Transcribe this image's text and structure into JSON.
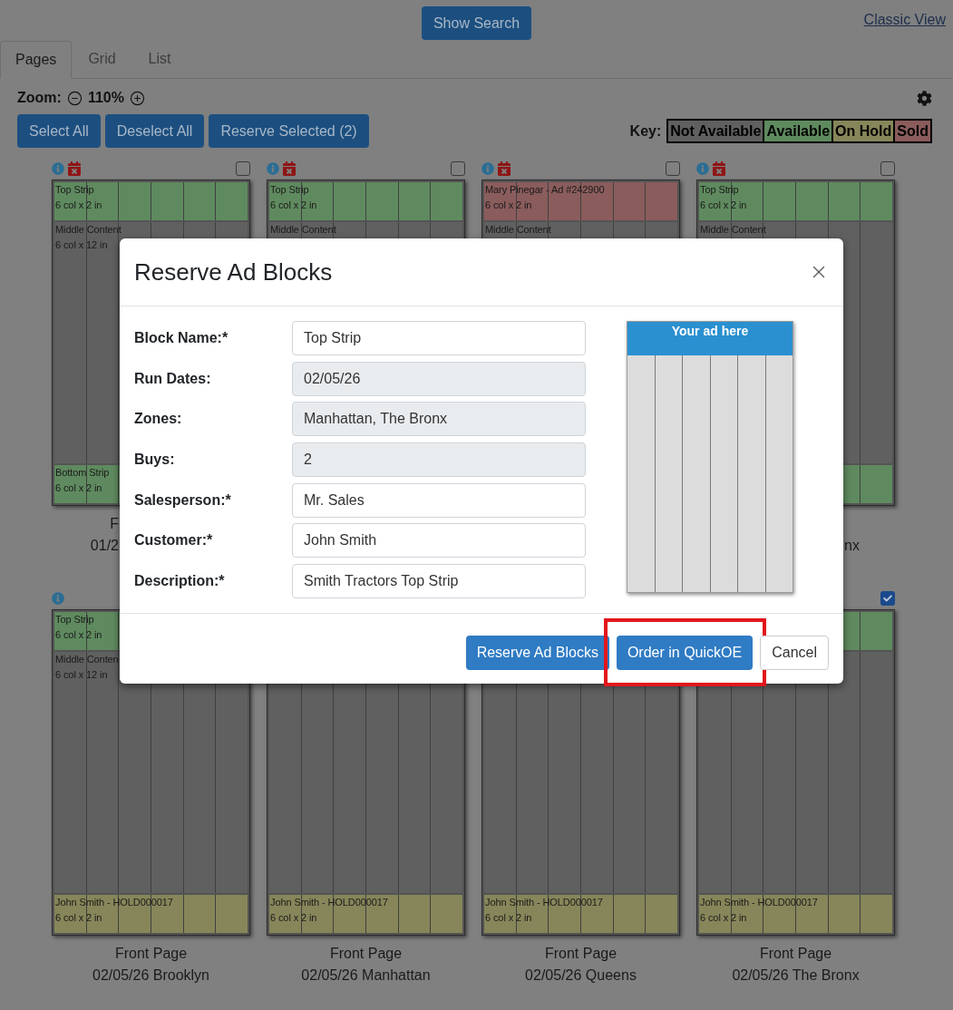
{
  "header": {
    "search_button": "Show Search",
    "classic_view_link": "Classic View"
  },
  "tabs": [
    {
      "label": "Pages",
      "selected": true
    },
    {
      "label": "Grid",
      "selected": false
    },
    {
      "label": "List",
      "selected": false
    }
  ],
  "toolbar": {
    "zoom_label": "Zoom:",
    "zoom_value": "110%",
    "buttons": [
      "Select All",
      "Deselect All",
      "Reserve Selected (2)"
    ]
  },
  "key": {
    "label": "Key:",
    "items": [
      {
        "label": "Not Available",
        "color": "#606060"
      },
      {
        "label": "Available",
        "color": "#5f8a5f"
      },
      {
        "label": "On Hold",
        "color": "#86865a"
      },
      {
        "label": "Sold",
        "color": "#8a5c5c"
      }
    ]
  },
  "page_rows": [
    {
      "cards": [
        {
          "info": true,
          "calendar_alert": true,
          "checkbox": {
            "checked": false
          },
          "strips": [
            {
              "kind": "strip",
              "color": "#5f8a5f",
              "lines": [
                "Top Strip",
                "6 col x 2 in"
              ]
            },
            {
              "kind": "content",
              "color": "#606060",
              "lines": [
                "Middle Content",
                "6 col x 12 in"
              ]
            },
            {
              "kind": "strip",
              "color": "#5f8a5f",
              "lines": [
                "Bottom Strip",
                "6 col x 2 in"
              ]
            }
          ],
          "caption": {
            "title": "F",
            "subtitle": "01/2"
          }
        },
        {
          "info": true,
          "calendar_alert": true,
          "checkbox": {
            "checked": false
          },
          "strips": [
            {
              "kind": "strip",
              "color": "#5f8a5f",
              "lines": [
                "Top Strip",
                "6 col x 2 in"
              ]
            },
            {
              "kind": "content",
              "color": "#606060",
              "lines": [
                "Middle Content"
              ]
            }
          ]
        },
        {
          "info": true,
          "calendar_alert": true,
          "checkbox": {
            "checked": false
          },
          "strips": [
            {
              "kind": "strip",
              "color": "#8a5c5c",
              "lines": [
                "Mary Pinegar - Ad #242900",
                "6 col x 2 in"
              ]
            },
            {
              "kind": "content",
              "color": "#606060",
              "lines": [
                "Middle Content"
              ]
            }
          ]
        },
        {
          "info": true,
          "calendar_alert": true,
          "checkbox": {
            "checked": false
          },
          "strips": [
            {
              "kind": "strip",
              "color": "#5f8a5f",
              "lines": [
                "Top Strip",
                "6 col x 2 in"
              ]
            },
            {
              "kind": "content",
              "color": "#606060",
              "lines": [
                "Middle Content"
              ]
            },
            {
              "kind": "strip",
              "color": "#5f8a5f"
            }
          ],
          "caption": {
            "subtitle": "nx"
          }
        }
      ]
    },
    {
      "cards": [
        {
          "info": true,
          "strips": [
            {
              "kind": "strip",
              "color": "#5f8a5f",
              "lines": [
                "Top Strip",
                "6 col x 2 in"
              ]
            },
            {
              "kind": "content",
              "color": "#606060",
              "lines": [
                "Middle Conten",
                "6 col x 12 in"
              ]
            },
            {
              "kind": "strip",
              "color": "#86865a",
              "lines": [
                "John Smith - HOLD000017",
                "6 col x 2 in"
              ]
            }
          ],
          "caption": {
            "title": "Front Page",
            "subtitle": "02/05/26 Brooklyn"
          }
        },
        {
          "strips": [
            {
              "kind": "content",
              "color": "#606060"
            },
            {
              "kind": "strip",
              "color": "#86865a",
              "lines": [
                "John Smith - HOLD000017",
                "6 col x 2 in"
              ]
            }
          ],
          "caption": {
            "title": "Front Page",
            "subtitle": "02/05/26 Manhattan"
          }
        },
        {
          "strips": [
            {
              "kind": "content",
              "color": "#606060"
            },
            {
              "kind": "strip",
              "color": "#86865a",
              "lines": [
                "John Smith - HOLD000017",
                "6 col x 2 in"
              ]
            }
          ],
          "caption": {
            "title": "Front Page",
            "subtitle": "02/05/26 Queens"
          }
        },
        {
          "checkbox": {
            "checked": true
          },
          "strips": [
            {
              "kind": "strip",
              "color": "#5f8a5f"
            },
            {
              "kind": "content",
              "color": "#606060"
            },
            {
              "kind": "strip",
              "color": "#86865a",
              "lines": [
                "John Smith - HOLD000017",
                "6 col x 2 in"
              ]
            }
          ],
          "caption": {
            "title": "Front Page",
            "subtitle": "02/05/26 The Bronx"
          }
        }
      ]
    }
  ],
  "modal": {
    "title": "Reserve Ad Blocks",
    "fields": [
      {
        "label": "Block Name:*",
        "value": "Top Strip",
        "disabled": false
      },
      {
        "label": "Run Dates:",
        "value": "02/05/26",
        "disabled": true
      },
      {
        "label": "Zones:",
        "value": "Manhattan, The Bronx",
        "disabled": true
      },
      {
        "label": "Buys:",
        "value": "2",
        "disabled": true
      },
      {
        "label": "Salesperson:*",
        "value": "Mr. Sales",
        "disabled": false
      },
      {
        "label": "Customer:*",
        "value": "John Smith",
        "disabled": false
      },
      {
        "label": "Description:*",
        "value": "Smith Tractors Top Strip",
        "disabled": false
      }
    ],
    "preview": {
      "banner": "Your ad here"
    },
    "buttons": [
      {
        "label": "Reserve Ad Blocks",
        "kind": "primary",
        "highlighted": false
      },
      {
        "label": "Order in QuickOE",
        "kind": "primary",
        "highlighted": true
      },
      {
        "label": "Cancel",
        "kind": "secondary",
        "highlighted": false
      }
    ]
  }
}
